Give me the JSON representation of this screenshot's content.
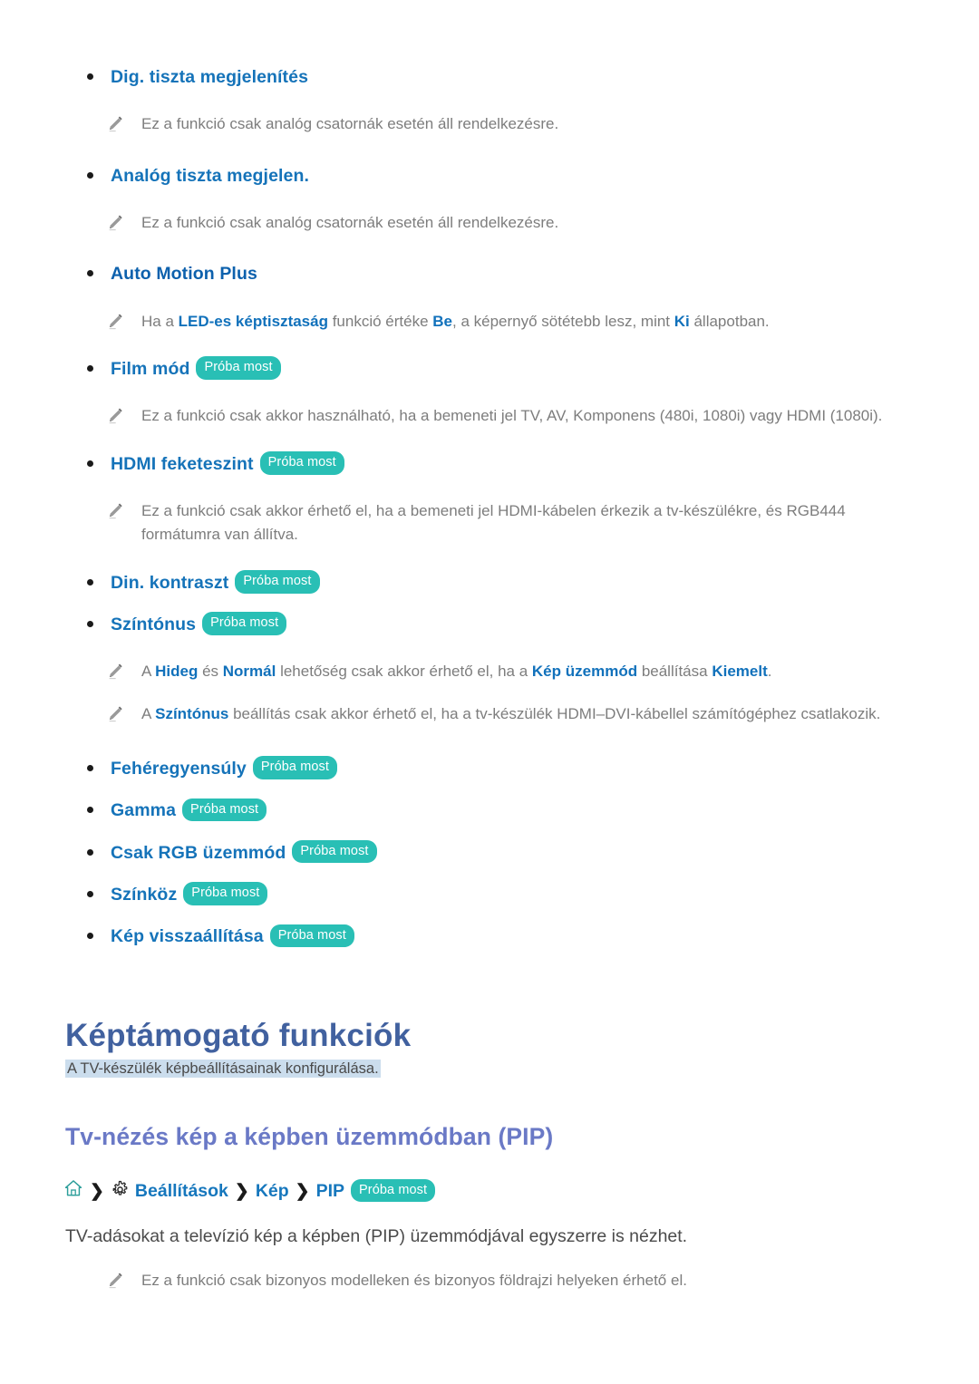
{
  "badge_label": "Próba most",
  "colors": {
    "link_blue": "#1573b9",
    "strong_blue": "#0d61ad",
    "badge_teal": "#29bfb5",
    "chapter_blue": "#41619f",
    "section_purple": "#6a79c6",
    "highlight_bg": "#cbdded",
    "note_gray": "#7d7d7d"
  },
  "items": {
    "dig_tiszta": "Dig. tiszta megjelenítés",
    "dig_tiszta_note": "Ez a funkció csak analóg csatornák esetén áll rendelkezésre.",
    "analog_tiszta": "Analóg tiszta megjelen.",
    "analog_tiszta_note": "Ez a funkció csak analóg csatornák esetén áll rendelkezésre.",
    "auto_motion": "Auto Motion Plus",
    "auto_motion_note": {
      "p1": "Ha a ",
      "b1": "LED-es képtisztaság",
      "p2": " funkció értéke ",
      "b2": "Be",
      "p3": ", a képernyő sötétebb lesz, mint ",
      "b3": "Ki",
      "p4": " állapotban."
    },
    "film_mod": "Film mód",
    "film_mod_note": "Ez a funkció csak akkor használható, ha a bemeneti jel TV, AV, Komponens (480i, 1080i) vagy HDMI (1080i).",
    "hdmi_feketeszint": "HDMI feketeszint",
    "hdmi_feketeszint_note": "Ez a funkció csak akkor érhető el, ha a bemeneti jel HDMI-kábelen érkezik a tv-készülékre, és RGB444 formátumra van állítva.",
    "din_kontraszt": "Din. kontraszt",
    "szintonus": "Színtónus",
    "szintonus_note1": {
      "p1": "A ",
      "b1": "Hideg",
      "p2": " és ",
      "b2": "Normál",
      "p3": " lehetőség csak akkor érhető el, ha a ",
      "b3": "Kép üzemmód",
      "p4": " beállítása ",
      "b4": "Kiemelt",
      "p5": "."
    },
    "szintonus_note2": {
      "p1": "A ",
      "b1": "Színtónus",
      "p2": " beállítás csak akkor érhető el, ha a tv-készülék HDMI–DVI-kábellel számítógéphez csatlakozik."
    },
    "feheregyensuly": "Fehéregyensúly",
    "gamma": "Gamma",
    "csak_rgb": "Csak RGB üzemmód",
    "szinkoz": "Színköz",
    "kep_visszaallitasa": "Kép visszaállítása"
  },
  "chapter": {
    "title": "Képtámogató funkciók",
    "subtitle": "A TV-készülék képbeállításainak konfigurálása."
  },
  "section": {
    "title": "Tv-nézés kép a képben üzemmódban (PIP)",
    "breadcrumb": {
      "home_icon": "home-icon",
      "gear_icon": "gear-icon",
      "chevron": "❯",
      "settings": "Beállítások",
      "picture": "Kép",
      "pip": "PIP",
      "badge": "Próba most"
    },
    "paragraph": "TV-adásokat a televízió kép a képben (PIP) üzemmódjával egyszerre is nézhet.",
    "note": "Ez a funkció csak bizonyos modelleken és bizonyos földrajzi helyeken érhető el."
  }
}
